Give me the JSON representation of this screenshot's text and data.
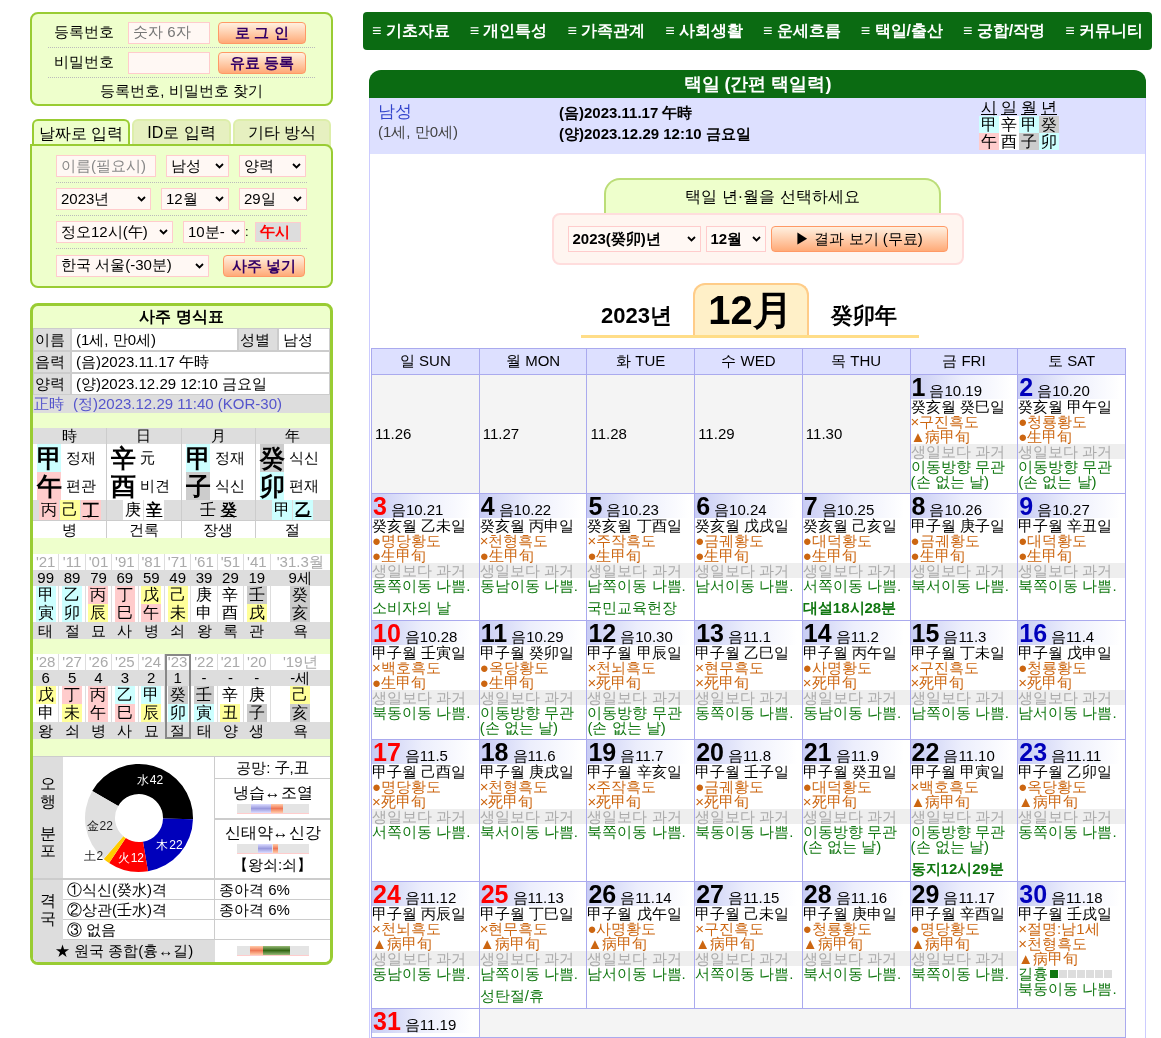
{
  "nav": [
    "≡ 기초자료",
    "≡ 개인특성",
    "≡ 가족관계",
    "≡ 사회생활",
    "≡ 운세흐름",
    "≡ 택일/출산",
    "≡ 궁합/작명",
    "≡ 커뮤니티"
  ],
  "login": {
    "id_label": "등록번호",
    "id_placeholder": "숫자 6자",
    "login_button": "로 그 인",
    "pw_label": "비밀번호",
    "register_button": "유료 등록",
    "find_link": "등록번호, 비밀번호 찾기"
  },
  "input_tabs": [
    {
      "label": "날짜로 입력",
      "selected": true
    },
    {
      "label": "ID로 입력",
      "selected": false
    },
    {
      "label": "기타 방식",
      "selected": false
    }
  ],
  "input_form": {
    "name_placeholder": "이름(필요시)",
    "gender": "남성",
    "calendar": "양력",
    "year": "2023년",
    "month": "12월",
    "day": "29일",
    "hour": "정오12시(午)",
    "minute": "10분-",
    "separator": ":",
    "hour_result": "午시",
    "location": "한국 서울(-30분)",
    "submit_button": "사주 넣기"
  },
  "saju": {
    "title": "사주 명식표",
    "name_label": "이름",
    "name_value": "(1세, 만0세)",
    "gender_label": "성별",
    "gender_value": "남성",
    "lunar_label": "음력",
    "lunar_value": "(음)2023.11.17 午時",
    "solar_label": "양력",
    "solar_value": "(양)2023.12.29 12:10 금요일",
    "true_time_label": "正時",
    "true_time_value": "(정)2023.12.29 11:40 (KOR-30)",
    "pillars": [
      {
        "heading": "時",
        "stem": {
          "char": "甲",
          "color": "#ccffff"
        },
        "stem_label": "정재",
        "branch": {
          "char": "午",
          "color": "#ffcccc"
        },
        "branch_label": "편관",
        "hidden": [
          {
            "char": "丙",
            "color": "#ffcccc",
            "main": false
          },
          {
            "char": "己",
            "color": "#ffff99",
            "main": false
          },
          {
            "char": "丁",
            "color": "#ffcccc",
            "main": true
          }
        ],
        "stage": "병"
      },
      {
        "heading": "日",
        "stem": {
          "char": "辛",
          "color": "#ffffff"
        },
        "stem_label": "元",
        "branch": {
          "char": "酉",
          "color": "#ffffff"
        },
        "branch_label": "비견",
        "hidden": [
          {
            "char": "庚",
            "color": "#ffffff",
            "main": false
          },
          {
            "char": "辛",
            "color": "#ffffff",
            "main": true
          }
        ],
        "stage": "건록"
      },
      {
        "heading": "月",
        "stem": {
          "char": "甲",
          "color": "#ccffff"
        },
        "stem_label": "정재",
        "branch": {
          "char": "子",
          "color": "#cccccc"
        },
        "branch_label": "식신",
        "hidden": [
          {
            "char": "壬",
            "color": "#dddddd",
            "main": false
          },
          {
            "char": "癸",
            "color": "#dddddd",
            "main": true
          }
        ],
        "stage": "장생"
      },
      {
        "heading": "年",
        "stem": {
          "char": "癸",
          "color": "#cccccc"
        },
        "stem_label": "식신",
        "branch": {
          "char": "卯",
          "color": "#ccffff"
        },
        "branch_label": "편재",
        "hidden": [
          {
            "char": "甲",
            "color": "#ccffff",
            "main": false
          },
          {
            "char": "乙",
            "color": "#ccffff",
            "main": true
          }
        ],
        "stage": "절"
      }
    ],
    "daewoon": [
      {
        "year": "'21",
        "age": "99",
        "stem": {
          "char": "甲",
          "color": "#ccffff"
        },
        "branch": {
          "char": "寅",
          "color": "#ccffff"
        },
        "stage": "태"
      },
      {
        "year": "'11",
        "age": "89",
        "stem": {
          "char": "乙",
          "color": "#ccffff"
        },
        "branch": {
          "char": "卯",
          "color": "#ccffff"
        },
        "stage": "절"
      },
      {
        "year": "'01",
        "age": "79",
        "stem": {
          "char": "丙",
          "color": "#ffcccc"
        },
        "branch": {
          "char": "辰",
          "color": "#ffff99"
        },
        "stage": "묘"
      },
      {
        "year": "'91",
        "age": "69",
        "stem": {
          "char": "丁",
          "color": "#ffcccc"
        },
        "branch": {
          "char": "巳",
          "color": "#ffcccc"
        },
        "stage": "사"
      },
      {
        "year": "'81",
        "age": "59",
        "stem": {
          "char": "戊",
          "color": "#ffff99"
        },
        "branch": {
          "char": "午",
          "color": "#ffcccc"
        },
        "stage": "병"
      },
      {
        "year": "'71",
        "age": "49",
        "stem": {
          "char": "己",
          "color": "#ffff99"
        },
        "branch": {
          "char": "未",
          "color": "#ffff99"
        },
        "stage": "쇠"
      },
      {
        "year": "'61",
        "age": "39",
        "stem": {
          "char": "庚",
          "color": "#ffffff"
        },
        "branch": {
          "char": "申",
          "color": "#ffffff"
        },
        "stage": "왕"
      },
      {
        "year": "'51",
        "age": "29",
        "stem": {
          "char": "辛",
          "color": "#ffffff"
        },
        "branch": {
          "char": "酉",
          "color": "#ffffff"
        },
        "stage": "록"
      },
      {
        "year": "'41",
        "age": "19",
        "stem": {
          "char": "壬",
          "color": "#cccccc"
        },
        "branch": {
          "char": "戌",
          "color": "#ffff99"
        },
        "stage": "관"
      },
      {
        "year": "'31.3월",
        "age": "9세",
        "stem": {
          "char": "癸",
          "color": "#cccccc"
        },
        "branch": {
          "char": "亥",
          "color": "#cccccc"
        },
        "stage": "욕"
      }
    ],
    "yearly": [
      {
        "year": "'28",
        "age": "6",
        "stem": {
          "char": "戊",
          "color": "#ffff99"
        },
        "branch": {
          "char": "申",
          "color": "#ffffff"
        },
        "stage": "왕",
        "selected": false
      },
      {
        "year": "'27",
        "age": "5",
        "stem": {
          "char": "丁",
          "color": "#ffcccc"
        },
        "branch": {
          "char": "未",
          "color": "#ffff99"
        },
        "stage": "쇠",
        "selected": false
      },
      {
        "year": "'26",
        "age": "4",
        "stem": {
          "char": "丙",
          "color": "#ffcccc"
        },
        "branch": {
          "char": "午",
          "color": "#ffcccc"
        },
        "stage": "병",
        "selected": false
      },
      {
        "year": "'25",
        "age": "3",
        "stem": {
          "char": "乙",
          "color": "#ccffff"
        },
        "branch": {
          "char": "巳",
          "color": "#ffcccc"
        },
        "stage": "사",
        "selected": false
      },
      {
        "year": "'24",
        "age": "2",
        "stem": {
          "char": "甲",
          "color": "#ccffff"
        },
        "branch": {
          "char": "辰",
          "color": "#ffff99"
        },
        "stage": "묘",
        "selected": false
      },
      {
        "year": "'23",
        "age": "1",
        "stem": {
          "char": "癸",
          "color": "#cccccc"
        },
        "branch": {
          "char": "卯",
          "color": "#ccffff"
        },
        "stage": "절",
        "selected": true
      },
      {
        "year": "'22",
        "age": "-",
        "stem": {
          "char": "壬",
          "color": "#cccccc"
        },
        "branch": {
          "char": "寅",
          "color": "#ccffff"
        },
        "stage": "태",
        "selected": false
      },
      {
        "year": "'21",
        "age": "-",
        "stem": {
          "char": "辛",
          "color": "#ffffff"
        },
        "branch": {
          "char": "丑",
          "color": "#ffff99"
        },
        "stage": "양",
        "selected": false
      },
      {
        "year": "'20",
        "age": "-",
        "stem": {
          "char": "庚",
          "color": "#ffffff"
        },
        "branch": {
          "char": "子",
          "color": "#cccccc"
        },
        "stage": "생",
        "selected": false
      },
      {
        "year": "'19년",
        "age": "-세",
        "stem": {
          "char": "己",
          "color": "#ffff99"
        },
        "branch": {
          "char": "亥",
          "color": "#cccccc"
        },
        "stage": "욕",
        "selected": false
      }
    ],
    "elements_label": [
      "오행",
      "분포"
    ],
    "elements_chart": {
      "chart_data": {
        "type": "donut",
        "categories": [
          "水",
          "木",
          "火",
          "土",
          "金"
        ],
        "values": [
          42,
          22,
          12,
          2,
          22
        ],
        "colors": [
          "#000000",
          "#0000bb",
          "#ff0000",
          "#ffcc00",
          "#e0e0e0"
        ],
        "data_labels": true
      }
    },
    "gongmang": "공망: 子,丑",
    "scale_1": "냉습↔조열",
    "scale_2": "신태약↔신강",
    "wangsoe": "【왕쇠:쇠】",
    "gyeokguk_label": "격국",
    "gyeokguk": [
      {
        "name": "①식신(癸水)격",
        "result": "종아격 6%"
      },
      {
        "name": "②상관(壬水)격",
        "result": "종아격 6%"
      },
      {
        "name": "③ 없음"
      }
    ],
    "summary": "★ 원국 종합(흉↔길)"
  },
  "page_title": "택일 (간편 택일력)",
  "person": {
    "gender": "남성",
    "age": "(1세, 만0세)",
    "lunar": "(음)2023.11.17 午時",
    "solar": "(양)2023.12.29 12:10 금요일",
    "mini_pillars": [
      {
        "heading": "시",
        "stem": {
          "char": "甲",
          "color": "#ccffff"
        },
        "branch": {
          "char": "午",
          "color": "#ffcccc"
        }
      },
      {
        "heading": "일",
        "stem": {
          "char": "辛",
          "color": "#ffffff"
        },
        "branch": {
          "char": "酉",
          "color": "#ffffff"
        }
      },
      {
        "heading": "월",
        "stem": {
          "char": "甲",
          "color": "#ccffff"
        },
        "branch": {
          "char": "子",
          "color": "#cccccc"
        }
      },
      {
        "heading": "년",
        "stem": {
          "char": "癸",
          "color": "#cccccc"
        },
        "branch": {
          "char": "卯",
          "color": "#ccffff"
        }
      }
    ]
  },
  "picker": {
    "title": "택일 년·월을 선택하세요",
    "year": "2023(癸卯)년",
    "month": "12월",
    "button": "▶ 결과 보기 (무료)"
  },
  "month_heading": {
    "year": "2023년",
    "month": "12月",
    "ganji_year": "癸卯年"
  },
  "calendar": {
    "weekdays": [
      "일 SUN",
      "월 MON",
      "화 TUE",
      "수 WED",
      "목 THU",
      "금 FRI",
      "토 SAT"
    ],
    "leading_days": [
      "11.26",
      "11.27",
      "11.28",
      "11.29",
      "11.30"
    ],
    "days": [
      {
        "day": "1",
        "kind": "weekday",
        "lunar": "음10.19",
        "ganji": "癸亥월 癸巳일",
        "lines": [
          {
            "kind": "omen",
            "text": "×구진흑도"
          },
          {
            "kind": "omen",
            "text": "▲病甲旬"
          },
          {
            "kind": "past",
            "text": "생일보다 과거"
          },
          {
            "kind": "move",
            "text": "이동방향 무관"
          },
          {
            "kind": "move",
            "text": "(손 없는 날)"
          }
        ]
      },
      {
        "day": "2",
        "kind": "saturday",
        "lunar": "음10.20",
        "ganji": "癸亥월 甲午일",
        "lines": [
          {
            "kind": "omen",
            "text": "●청룡황도"
          },
          {
            "kind": "omen",
            "text": "●生甲旬"
          },
          {
            "kind": "past",
            "text": "생일보다 과거"
          },
          {
            "kind": "move",
            "text": "이동방향 무관"
          },
          {
            "kind": "move",
            "text": "(손 없는 날)"
          }
        ]
      },
      {
        "day": "3",
        "kind": "sunday",
        "lunar": "음10.21",
        "ganji": "癸亥월 乙未일",
        "lines": [
          {
            "kind": "omen",
            "text": "●명당황도"
          },
          {
            "kind": "omen",
            "text": "●生甲旬"
          },
          {
            "kind": "past",
            "text": "생일보다 과거"
          },
          {
            "kind": "move",
            "text": "동쪽이동 나쁨."
          }
        ],
        "event": {
          "text": "소비자의 날",
          "bold": false
        }
      },
      {
        "day": "4",
        "kind": "weekday",
        "lunar": "음10.22",
        "ganji": "癸亥월 丙申일",
        "lines": [
          {
            "kind": "omen",
            "text": "×천형흑도"
          },
          {
            "kind": "omen",
            "text": "●生甲旬"
          },
          {
            "kind": "past",
            "text": "생일보다 과거"
          },
          {
            "kind": "move",
            "text": "동남이동 나쁨."
          }
        ]
      },
      {
        "day": "5",
        "kind": "weekday",
        "lunar": "음10.23",
        "ganji": "癸亥월 丁酉일",
        "lines": [
          {
            "kind": "omen",
            "text": "×주작흑도"
          },
          {
            "kind": "omen",
            "text": "●生甲旬"
          },
          {
            "kind": "past",
            "text": "생일보다 과거"
          },
          {
            "kind": "move",
            "text": "남쪽이동 나쁨."
          }
        ],
        "event": {
          "text": "국민교육헌장",
          "bold": false
        }
      },
      {
        "day": "6",
        "kind": "weekday",
        "lunar": "음10.24",
        "ganji": "癸亥월 戊戌일",
        "lines": [
          {
            "kind": "omen",
            "text": "●금궤황도"
          },
          {
            "kind": "omen",
            "text": "●生甲旬"
          },
          {
            "kind": "past",
            "text": "생일보다 과거"
          },
          {
            "kind": "move",
            "text": "남서이동 나쁨."
          }
        ]
      },
      {
        "day": "7",
        "kind": "weekday",
        "lunar": "음10.25",
        "ganji": "癸亥월 己亥일",
        "lines": [
          {
            "kind": "omen",
            "text": "●대덕황도"
          },
          {
            "kind": "omen",
            "text": "●生甲旬"
          },
          {
            "kind": "past",
            "text": "생일보다 과거"
          },
          {
            "kind": "move",
            "text": "서쪽이동 나쁨."
          }
        ],
        "event": {
          "text": "대설18시28분",
          "bold": true
        }
      },
      {
        "day": "8",
        "kind": "weekday",
        "lunar": "음10.26",
        "ganji": "甲子월 庚子일",
        "lines": [
          {
            "kind": "omen",
            "text": "●금궤황도"
          },
          {
            "kind": "omen",
            "text": "●生甲旬"
          },
          {
            "kind": "past",
            "text": "생일보다 과거"
          },
          {
            "kind": "move",
            "text": "북서이동 나쁨."
          }
        ]
      },
      {
        "day": "9",
        "kind": "saturday",
        "lunar": "음10.27",
        "ganji": "甲子월 辛丑일",
        "lines": [
          {
            "kind": "omen",
            "text": "●대덕황도"
          },
          {
            "kind": "omen",
            "text": "●生甲旬"
          },
          {
            "kind": "past",
            "text": "생일보다 과거"
          },
          {
            "kind": "move",
            "text": "북쪽이동 나쁨."
          }
        ]
      },
      {
        "day": "10",
        "kind": "sunday",
        "lunar": "음10.28",
        "ganji": "甲子월 壬寅일",
        "lines": [
          {
            "kind": "omen",
            "text": "×백호흑도"
          },
          {
            "kind": "omen",
            "text": "●生甲旬"
          },
          {
            "kind": "past",
            "text": "생일보다 과거"
          },
          {
            "kind": "move",
            "text": "북동이동 나쁨."
          }
        ]
      },
      {
        "day": "11",
        "kind": "weekday",
        "lunar": "음10.29",
        "ganji": "甲子월 癸卯일",
        "lines": [
          {
            "kind": "omen",
            "text": "●옥당황도"
          },
          {
            "kind": "omen",
            "text": "●生甲旬"
          },
          {
            "kind": "past",
            "text": "생일보다 과거"
          },
          {
            "kind": "move",
            "text": "이동방향 무관"
          },
          {
            "kind": "move",
            "text": "(손 없는 날)"
          }
        ]
      },
      {
        "day": "12",
        "kind": "weekday",
        "lunar": "음10.30",
        "ganji": "甲子월 甲辰일",
        "lines": [
          {
            "kind": "omen",
            "text": "×천뇌흑도"
          },
          {
            "kind": "omen",
            "text": "×死甲旬"
          },
          {
            "kind": "past",
            "text": "생일보다 과거"
          },
          {
            "kind": "move",
            "text": "이동방향 무관"
          },
          {
            "kind": "move",
            "text": "(손 없는 날)"
          }
        ]
      },
      {
        "day": "13",
        "kind": "weekday",
        "lunar": "음11.1",
        "ganji": "甲子월 乙巳일",
        "lines": [
          {
            "kind": "omen",
            "text": "×현무흑도"
          },
          {
            "kind": "omen",
            "text": "×死甲旬"
          },
          {
            "kind": "past",
            "text": "생일보다 과거"
          },
          {
            "kind": "move",
            "text": "동쪽이동 나쁨."
          }
        ]
      },
      {
        "day": "14",
        "kind": "weekday",
        "lunar": "음11.2",
        "ganji": "甲子월 丙午일",
        "lines": [
          {
            "kind": "omen",
            "text": "●사명황도"
          },
          {
            "kind": "omen",
            "text": "×死甲旬"
          },
          {
            "kind": "past",
            "text": "생일보다 과거"
          },
          {
            "kind": "move",
            "text": "동남이동 나쁨."
          }
        ]
      },
      {
        "day": "15",
        "kind": "weekday",
        "lunar": "음11.3",
        "ganji": "甲子월 丁未일",
        "lines": [
          {
            "kind": "omen",
            "text": "×구진흑도"
          },
          {
            "kind": "omen",
            "text": "×死甲旬"
          },
          {
            "kind": "past",
            "text": "생일보다 과거"
          },
          {
            "kind": "move",
            "text": "남쪽이동 나쁨."
          }
        ]
      },
      {
        "day": "16",
        "kind": "saturday",
        "lunar": "음11.4",
        "ganji": "甲子월 戊申일",
        "lines": [
          {
            "kind": "omen",
            "text": "●청룡황도"
          },
          {
            "kind": "omen",
            "text": "×死甲旬"
          },
          {
            "kind": "past",
            "text": "생일보다 과거"
          },
          {
            "kind": "move",
            "text": "남서이동 나쁨."
          }
        ]
      },
      {
        "day": "17",
        "kind": "sunday",
        "lunar": "음11.5",
        "ganji": "甲子월 己酉일",
        "lines": [
          {
            "kind": "omen",
            "text": "●명당황도"
          },
          {
            "kind": "omen",
            "text": "×死甲旬"
          },
          {
            "kind": "past",
            "text": "생일보다 과거"
          },
          {
            "kind": "move",
            "text": "서쪽이동 나쁨."
          }
        ]
      },
      {
        "day": "18",
        "kind": "weekday",
        "lunar": "음11.6",
        "ganji": "甲子월 庚戌일",
        "lines": [
          {
            "kind": "omen",
            "text": "×천형흑도"
          },
          {
            "kind": "omen",
            "text": "×死甲旬"
          },
          {
            "kind": "past",
            "text": "생일보다 과거"
          },
          {
            "kind": "move",
            "text": "북서이동 나쁨."
          }
        ]
      },
      {
        "day": "19",
        "kind": "weekday",
        "lunar": "음11.7",
        "ganji": "甲子월 辛亥일",
        "lines": [
          {
            "kind": "omen",
            "text": "×주작흑도"
          },
          {
            "kind": "omen",
            "text": "×死甲旬"
          },
          {
            "kind": "past",
            "text": "생일보다 과거"
          },
          {
            "kind": "move",
            "text": "북쪽이동 나쁨."
          }
        ]
      },
      {
        "day": "20",
        "kind": "weekday",
        "lunar": "음11.8",
        "ganji": "甲子월 壬子일",
        "lines": [
          {
            "kind": "omen",
            "text": "●금궤황도"
          },
          {
            "kind": "omen",
            "text": "×死甲旬"
          },
          {
            "kind": "past",
            "text": "생일보다 과거"
          },
          {
            "kind": "move",
            "text": "북동이동 나쁨."
          }
        ]
      },
      {
        "day": "21",
        "kind": "weekday",
        "lunar": "음11.9",
        "ganji": "甲子월 癸丑일",
        "lines": [
          {
            "kind": "omen",
            "text": "●대덕황도"
          },
          {
            "kind": "omen",
            "text": "×死甲旬"
          },
          {
            "kind": "past",
            "text": "생일보다 과거"
          },
          {
            "kind": "move",
            "text": "이동방향 무관"
          },
          {
            "kind": "move",
            "text": "(손 없는 날)"
          }
        ]
      },
      {
        "day": "22",
        "kind": "weekday",
        "lunar": "음11.10",
        "ganji": "甲子월 甲寅일",
        "lines": [
          {
            "kind": "omen",
            "text": "×백호흑도"
          },
          {
            "kind": "omen",
            "text": "▲病甲旬"
          },
          {
            "kind": "past",
            "text": "생일보다 과거"
          },
          {
            "kind": "move",
            "text": "이동방향 무관"
          },
          {
            "kind": "move",
            "text": "(손 없는 날)"
          }
        ],
        "event": {
          "text": "동지12시29분",
          "bold": true
        }
      },
      {
        "day": "23",
        "kind": "saturday",
        "lunar": "음11.11",
        "ganji": "甲子월 乙卯일",
        "lines": [
          {
            "kind": "omen",
            "text": "●옥당황도"
          },
          {
            "kind": "omen",
            "text": "▲病甲旬"
          },
          {
            "kind": "past",
            "text": "생일보다 과거"
          },
          {
            "kind": "move",
            "text": "동쪽이동 나쁨."
          }
        ]
      },
      {
        "day": "24",
        "kind": "sunday",
        "lunar": "음11.12",
        "ganji": "甲子월 丙辰일",
        "lines": [
          {
            "kind": "omen",
            "text": "×천뇌흑도"
          },
          {
            "kind": "omen",
            "text": "▲病甲旬"
          },
          {
            "kind": "past",
            "text": "생일보다 과거"
          },
          {
            "kind": "move",
            "text": "동남이동 나쁨."
          }
        ]
      },
      {
        "day": "25",
        "kind": "holiday",
        "lunar": "음11.13",
        "ganji": "甲子월 丁巳일",
        "lines": [
          {
            "kind": "omen",
            "text": "×현무흑도"
          },
          {
            "kind": "omen",
            "text": "▲病甲旬"
          },
          {
            "kind": "past",
            "text": "생일보다 과거"
          },
          {
            "kind": "move",
            "text": "남쪽이동 나쁨."
          }
        ],
        "event": {
          "text": "성탄절/휴",
          "bold": false
        }
      },
      {
        "day": "26",
        "kind": "weekday",
        "lunar": "음11.14",
        "ganji": "甲子월 戊午일",
        "lines": [
          {
            "kind": "omen",
            "text": "●사명황도"
          },
          {
            "kind": "omen",
            "text": "▲病甲旬"
          },
          {
            "kind": "past",
            "text": "생일보다 과거"
          },
          {
            "kind": "move",
            "text": "남서이동 나쁨."
          }
        ]
      },
      {
        "day": "27",
        "kind": "weekday",
        "lunar": "음11.15",
        "ganji": "甲子월 己未일",
        "lines": [
          {
            "kind": "omen",
            "text": "×구진흑도"
          },
          {
            "kind": "omen",
            "text": "▲病甲旬"
          },
          {
            "kind": "past",
            "text": "생일보다 과거"
          },
          {
            "kind": "move",
            "text": "서쪽이동 나쁨."
          }
        ]
      },
      {
        "day": "28",
        "kind": "weekday",
        "lunar": "음11.16",
        "ganji": "甲子월 庚申일",
        "lines": [
          {
            "kind": "omen",
            "text": "●청룡황도"
          },
          {
            "kind": "omen",
            "text": "▲病甲旬"
          },
          {
            "kind": "past",
            "text": "생일보다 과거"
          },
          {
            "kind": "move",
            "text": "북서이동 나쁨."
          }
        ]
      },
      {
        "day": "29",
        "kind": "weekday",
        "lunar": "음11.17",
        "ganji": "甲子월 辛酉일",
        "lines": [
          {
            "kind": "omen",
            "text": "●명당황도"
          },
          {
            "kind": "omen",
            "text": "▲病甲旬"
          },
          {
            "kind": "past",
            "text": "생일보다 과거"
          },
          {
            "kind": "move",
            "text": "북쪽이동 나쁨."
          }
        ]
      },
      {
        "day": "30",
        "kind": "saturday",
        "lunar": "음11.18",
        "ganji": "甲子월 壬戌일",
        "lines": [
          {
            "kind": "omen",
            "text": "×절명:남1세"
          },
          {
            "kind": "omen",
            "text": "×천형흑도"
          },
          {
            "kind": "omen",
            "text": "▲病甲旬"
          },
          {
            "kind": "meter",
            "text": "길흉",
            "level": 0.14
          },
          {
            "kind": "move",
            "text": "북동이동 나쁨."
          }
        ]
      },
      {
        "day": "31",
        "kind": "sunday",
        "lunar": "음11.19"
      }
    ]
  }
}
